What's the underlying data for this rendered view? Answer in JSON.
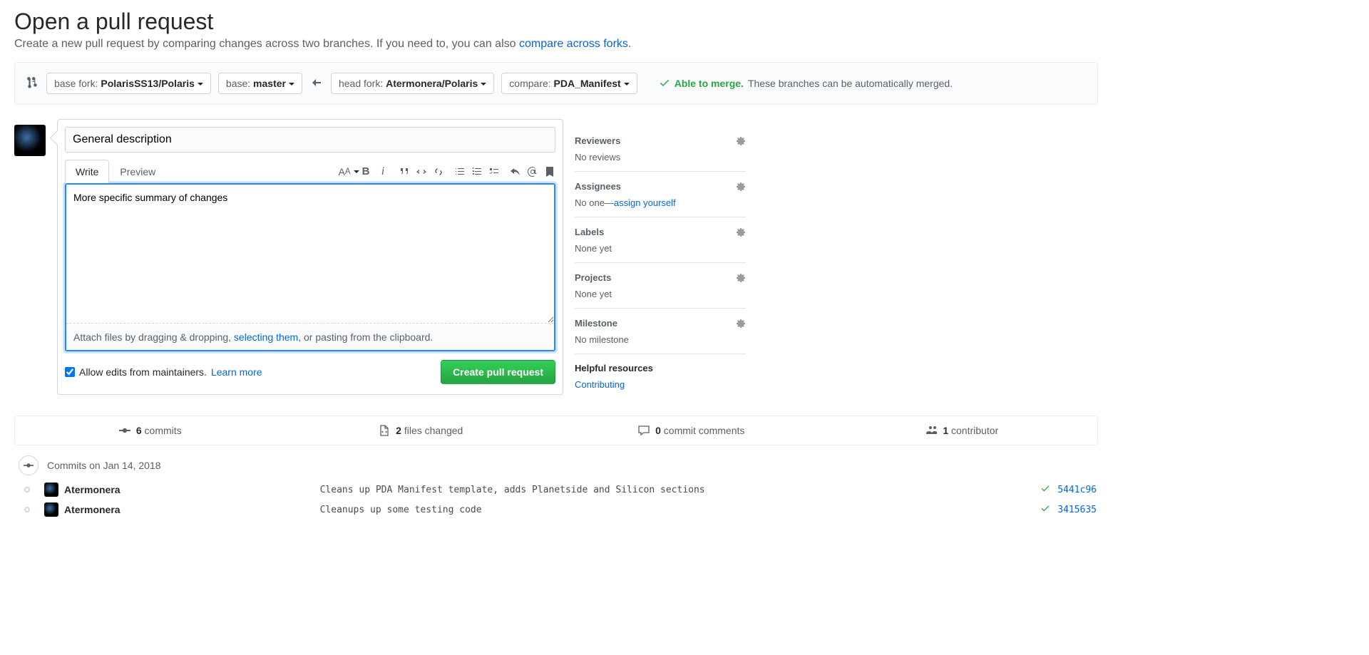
{
  "header": {
    "title": "Open a pull request",
    "subtitle_prefix": "Create a new pull request by comparing changes across two branches. If you need to, you can also ",
    "compare_forks_link": "compare across forks",
    "subtitle_suffix": "."
  },
  "compare": {
    "base_fork_label": "base fork: ",
    "base_fork_value": "PolarisSS13/Polaris",
    "base_label": "base: ",
    "base_value": "master",
    "head_fork_label": "head fork: ",
    "head_fork_value": "Atermonera/Polaris",
    "compare_label": "compare: ",
    "compare_value": "PDA_Manifest",
    "merge_status": "Able to merge.",
    "merge_msg": "These branches can be automatically merged."
  },
  "editor": {
    "title_value": "General description",
    "tabs": {
      "write": "Write",
      "preview": "Preview"
    },
    "toolbar": {
      "text_size": "Text size",
      "bold": "Bold",
      "italic": "Italic",
      "quote": "Quote",
      "code": "Code",
      "link": "Link",
      "ul": "Unordered list",
      "ol": "Ordered list",
      "tasks": "Task list",
      "reply": "Reply",
      "mention": "Mention",
      "ref": "Reference"
    },
    "description_value": "More specific summary of changes",
    "attach_prefix": "Attach files by dragging & dropping, ",
    "attach_link": "selecting them",
    "attach_suffix": ", or pasting from the clipboard.",
    "allow_edits_label": "Allow edits from maintainers.",
    "learn_more": "Learn more",
    "create_btn": "Create pull request"
  },
  "sidebar": {
    "reviewers": {
      "title": "Reviewers",
      "body": "No reviews"
    },
    "assignees": {
      "title": "Assignees",
      "body_prefix": "No one—",
      "assign_self": "assign yourself"
    },
    "labels": {
      "title": "Labels",
      "body": "None yet"
    },
    "projects": {
      "title": "Projects",
      "body": "None yet"
    },
    "milestone": {
      "title": "Milestone",
      "body": "No milestone"
    },
    "helpful": {
      "title": "Helpful resources",
      "link": "Contributing"
    }
  },
  "diffstat": {
    "commits_n": "6",
    "commits_t": "commits",
    "files_n": "2",
    "files_t": "files changed",
    "comments_n": "0",
    "comments_t": "commit comments",
    "contrib_n": "1",
    "contrib_t": "contributor"
  },
  "commits": {
    "group_title": "Commits on Jan 14, 2018",
    "rows": [
      {
        "author": "Atermonera",
        "msg": "Cleans up PDA Manifest template, adds Planetside and Silicon sections",
        "sha": "5441c96"
      },
      {
        "author": "Atermonera",
        "msg": "Cleanups up some testing code",
        "sha": "3415635"
      }
    ]
  }
}
